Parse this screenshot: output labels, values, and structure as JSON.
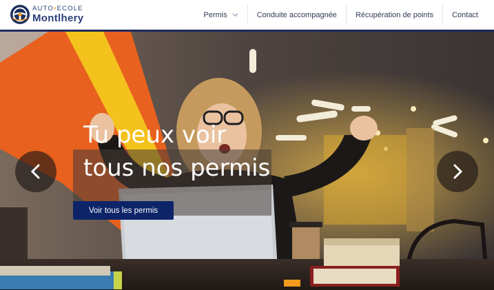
{
  "brand": {
    "top_left": "AUTO",
    "top_dot": "•",
    "top_right": "ECOLE",
    "name": "Montlhery",
    "icon": "steering-wheel-icon",
    "colors": {
      "navy": "#2a3f7a",
      "accent": "#f39a1e"
    }
  },
  "nav": {
    "items": [
      {
        "label": "Permis",
        "icon": "chevron-down-icon"
      },
      {
        "label": "Conduite accompagnée"
      },
      {
        "label": "Récupération de points"
      },
      {
        "label": "Contact"
      }
    ]
  },
  "hero": {
    "line1": "Tu peux voir",
    "line2": "tous nos permis",
    "cta_label": "Voir tous les permis",
    "prev_icon": "chevron-left-icon",
    "next_icon": "chevron-right-icon",
    "colors": {
      "cta": "#0d2469",
      "rule": "#1d2a5e"
    }
  }
}
